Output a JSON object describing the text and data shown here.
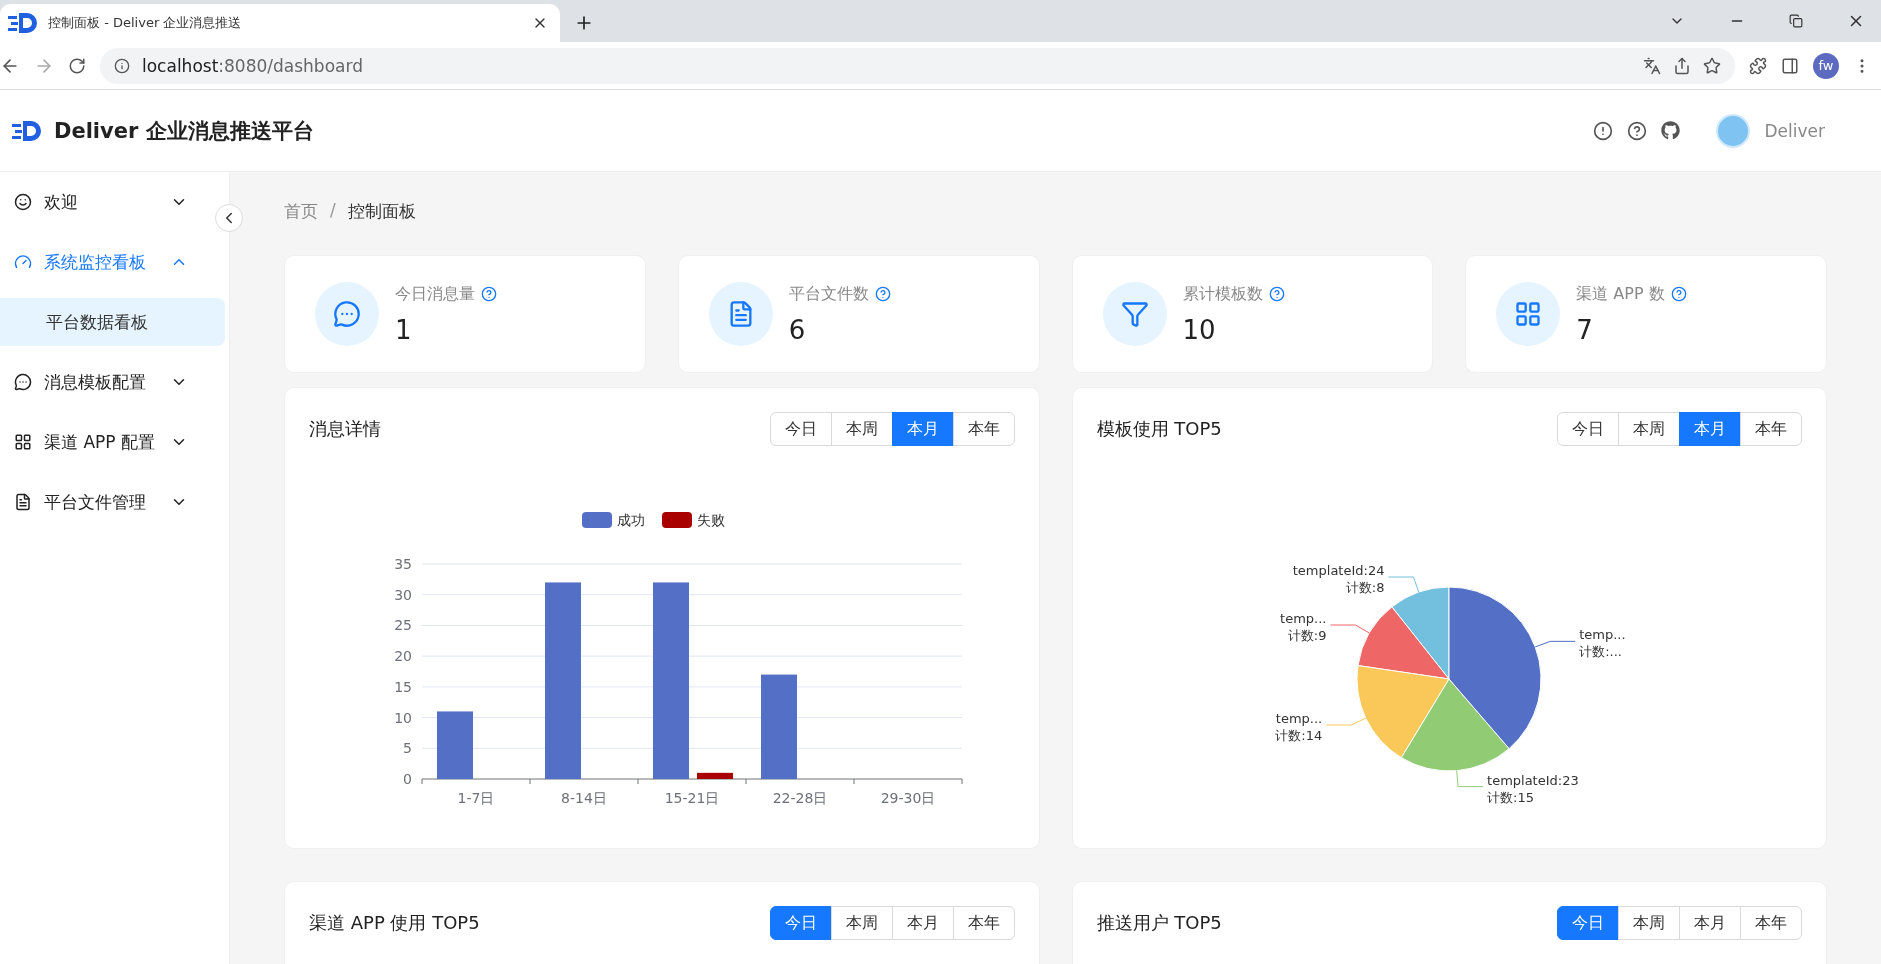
{
  "browser": {
    "tab_title": "控制面板 - Deliver 企业消息推送",
    "url_host": "localhost",
    "url_rest": ":8080/dashboard",
    "profile": "fw"
  },
  "header": {
    "title": "Deliver 企业消息推送平台",
    "user": "Deliver"
  },
  "sidebar": {
    "items": [
      {
        "label": "欢迎",
        "selected": false,
        "expanded": false
      },
      {
        "label": "系统监控看板",
        "selected": true,
        "expanded": true,
        "children": [
          {
            "label": "平台数据看板",
            "selected": true
          }
        ]
      },
      {
        "label": "消息模板配置",
        "selected": false,
        "expanded": false
      },
      {
        "label": "渠道 APP 配置",
        "selected": false,
        "expanded": false
      },
      {
        "label": "平台文件管理",
        "selected": false,
        "expanded": false
      }
    ]
  },
  "breadcrumb": {
    "items": [
      "首页",
      "控制面板"
    ],
    "separator": "/"
  },
  "stats": [
    {
      "label": "今日消息量",
      "value": "1"
    },
    {
      "label": "平台文件数",
      "value": "6"
    },
    {
      "label": "累计模板数",
      "value": "10"
    },
    {
      "label": "渠道 APP 数",
      "value": "7"
    }
  ],
  "cards": [
    {
      "title": "消息详情",
      "periods": [
        {
          "label": "今日",
          "selected": false
        },
        {
          "label": "本周",
          "selected": false
        },
        {
          "label": "本月",
          "selected": true
        },
        {
          "label": "本年",
          "selected": false
        }
      ],
      "chart_data": {
        "type": "bar",
        "categories": [
          "1-7日",
          "8-14日",
          "15-21日",
          "22-28日",
          "29-30日"
        ],
        "series": [
          {
            "name": "成功",
            "color": "#5470c6",
            "values": [
              11,
              32,
              32,
              17,
              0
            ]
          },
          {
            "name": "失败",
            "color": "#a90000",
            "values": [
              0,
              0,
              1,
              0,
              0
            ]
          }
        ],
        "ylim": [
          0,
          35
        ],
        "yticks": [
          0,
          5,
          10,
          15,
          20,
          25,
          30,
          35
        ],
        "grid": true,
        "legend": "top"
      }
    },
    {
      "title": "模板使用 TOP5",
      "periods": [
        {
          "label": "今日",
          "selected": false
        },
        {
          "label": "本周",
          "selected": false
        },
        {
          "label": "本月",
          "selected": true
        },
        {
          "label": "本年",
          "selected": false
        }
      ],
      "chart_data": {
        "type": "pie",
        "categories": [
          "templateId:24",
          "temp...",
          "temp...",
          "templateId:23",
          "temp..."
        ],
        "values": [
          8,
          9,
          14,
          15,
          29
        ],
        "colors": [
          "#73c0de",
          "#ee6666",
          "#fac858",
          "#91cc75",
          "#5470c6"
        ],
        "value_labels": [
          "计数:8",
          "计数:9",
          "计数:14",
          "计数:15",
          "计数:..."
        ]
      }
    },
    {
      "title": "渠道 APP 使用 TOP5",
      "periods": [
        {
          "label": "今日",
          "selected": true
        },
        {
          "label": "本周",
          "selected": false
        },
        {
          "label": "本月",
          "selected": false
        },
        {
          "label": "本年",
          "selected": false
        }
      ]
    },
    {
      "title": "推送用户 TOP5",
      "periods": [
        {
          "label": "今日",
          "selected": true
        },
        {
          "label": "本周",
          "selected": false
        },
        {
          "label": "本月",
          "selected": false
        },
        {
          "label": "本年",
          "selected": false
        }
      ]
    }
  ]
}
